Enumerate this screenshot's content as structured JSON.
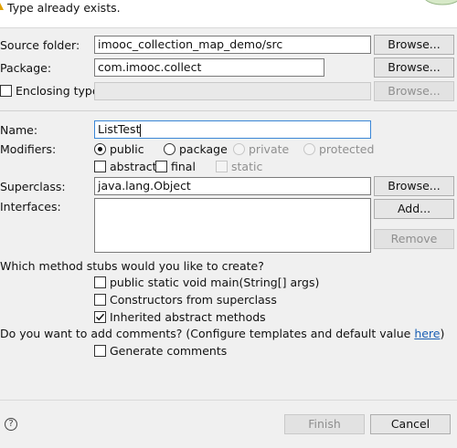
{
  "header": {
    "message": "Type already exists."
  },
  "form": {
    "source_folder": {
      "label": "Source folder:",
      "value": "imooc_collection_map_demo/src",
      "browse": "Browse..."
    },
    "package": {
      "label": "Package:",
      "value": "com.imooc.collect",
      "browse": "Browse..."
    },
    "enclosing_type": {
      "label": "Enclosing type:",
      "checked": false,
      "value": "",
      "browse": "Browse..."
    },
    "name": {
      "label": "Name:",
      "value": "ListTest"
    },
    "modifiers": {
      "label": "Modifiers:",
      "radios": [
        {
          "label": "public",
          "selected": true,
          "enabled": true
        },
        {
          "label": "package",
          "selected": false,
          "enabled": true
        },
        {
          "label": "private",
          "selected": false,
          "enabled": false
        },
        {
          "label": "protected",
          "selected": false,
          "enabled": false
        }
      ],
      "checkboxes": [
        {
          "label": "abstract",
          "checked": false,
          "enabled": true
        },
        {
          "label": "final",
          "checked": false,
          "enabled": true
        },
        {
          "label": "static",
          "checked": false,
          "enabled": false
        }
      ]
    },
    "superclass": {
      "label": "Superclass:",
      "value": "java.lang.Object",
      "browse": "Browse..."
    },
    "interfaces": {
      "label": "Interfaces:",
      "add": "Add...",
      "remove": "Remove"
    },
    "method_stubs": {
      "question": "Which method stubs would you like to create?",
      "options": [
        {
          "label": "public static void main(String[] args)",
          "checked": false
        },
        {
          "label": "Constructors from superclass",
          "checked": false
        },
        {
          "label": "Inherited abstract methods",
          "checked": true
        }
      ]
    },
    "comments": {
      "question_prefix": "Do you want to add comments? (Configure templates and default value ",
      "link": "here",
      "question_suffix": ")",
      "generate_label": "Generate comments",
      "generate_checked": false
    }
  },
  "footer": {
    "help": "?",
    "finish": "Finish",
    "cancel": "Cancel"
  },
  "colors": {
    "link": "#1a5fb4",
    "focus_border": "#3a86d6",
    "warning": "#e0a000"
  }
}
